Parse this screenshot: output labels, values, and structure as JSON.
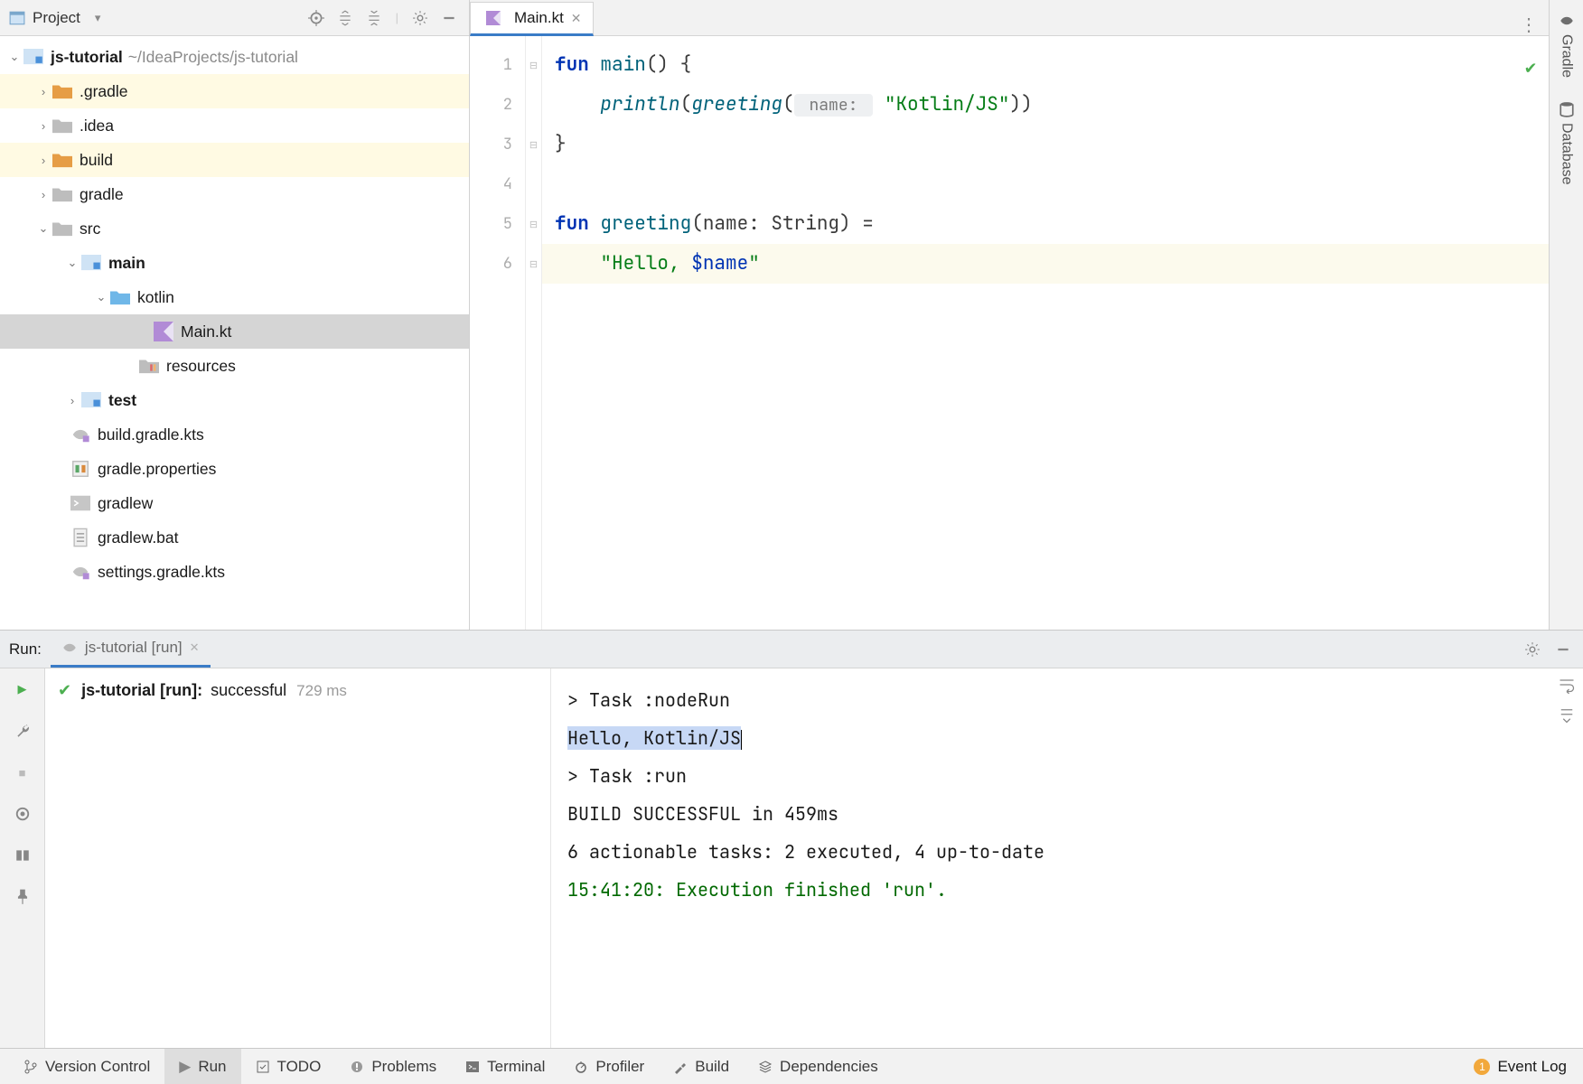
{
  "project_panel": {
    "title": "Project",
    "root": {
      "name": "js-tutorial",
      "path": "~/IdeaProjects/js-tutorial"
    },
    "nodes": {
      "gradle_dir": ".gradle",
      "idea_dir": ".idea",
      "build_dir": "build",
      "gradle": "gradle",
      "src": "src",
      "main": "main",
      "kotlin": "kotlin",
      "main_kt": "Main.kt",
      "resources": "resources",
      "test": "test",
      "build_gradle": "build.gradle.kts",
      "gradle_props": "gradle.properties",
      "gradlew": "gradlew",
      "gradlew_bat": "gradlew.bat",
      "settings_gradle": "settings.gradle.kts"
    }
  },
  "editor": {
    "tab": "Main.kt",
    "gutter": [
      "1",
      "2",
      "3",
      "4",
      "5",
      "6"
    ],
    "code": {
      "l1": {
        "kw": "fun ",
        "fn": "main",
        "rest": "() {"
      },
      "l2": {
        "indent": "    ",
        "fn": "println",
        "open": "(",
        "call": "greeting",
        "open2": "(",
        "hint": " name: ",
        "str": "\"Kotlin/JS\"",
        "close": "))"
      },
      "l3": "}",
      "l4": "",
      "l5": {
        "kw": "fun ",
        "fn": "greeting",
        "params": "(name: String) ="
      },
      "l6": {
        "indent": "    ",
        "q1": "\"",
        "txt": "Hello, ",
        "tpl": "$name",
        "q2": "\""
      }
    }
  },
  "right_rail": {
    "gradle": "Gradle",
    "database": "Database"
  },
  "run": {
    "label": "Run:",
    "tab": "js-tutorial [run]",
    "tree": {
      "name": "js-tutorial [run]:",
      "status": "successful",
      "time": "729 ms"
    },
    "console": {
      "l1": "> Task :nodeRun",
      "l2": "Hello, Kotlin/JS",
      "l3": "",
      "l4": "> Task :run",
      "l5": "",
      "l6": "BUILD SUCCESSFUL in 459ms",
      "l7": "6 actionable tasks: 2 executed, 4 up-to-date",
      "l8": "15:41:20: Execution finished 'run'."
    }
  },
  "status": {
    "version_control": "Version Control",
    "run": "Run",
    "todo": "TODO",
    "problems": "Problems",
    "terminal": "Terminal",
    "profiler": "Profiler",
    "build": "Build",
    "dependencies": "Dependencies",
    "event_log": "Event Log",
    "event_badge": "1"
  }
}
